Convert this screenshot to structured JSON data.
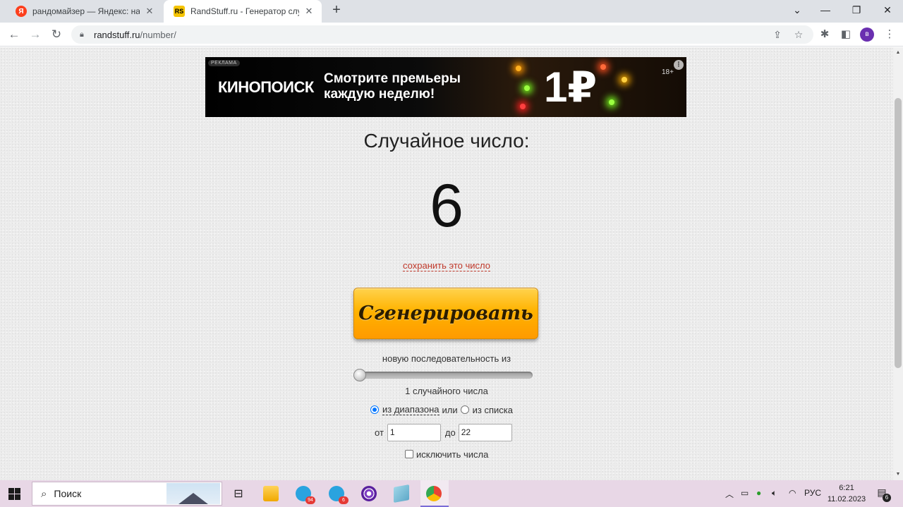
{
  "browser": {
    "tabs": [
      {
        "title": "рандомайзер — Яндекс: нашлос",
        "favicon": "yandex-icon",
        "active": false
      },
      {
        "title": "RandStuff.ru - Генератор случай",
        "favicon": "randstuff-icon",
        "active": true
      }
    ],
    "url_host": "randstuff.ru",
    "url_path": "/number/",
    "profile_initial": "в"
  },
  "ad": {
    "badge": "РЕКЛАМА",
    "brand": "КИНОПОИСК",
    "line1": "Смотрите премьеры",
    "line2": "каждую неделю!",
    "price": "1₽",
    "age": "18+"
  },
  "generator": {
    "heading": "Случайное число:",
    "number": "6",
    "save_link": "сохранить это число",
    "button": "Сгенерировать",
    "sequence_label": "новую последовательность из",
    "slider_value": 1,
    "count_label": "1 случайного числа",
    "mode_range": "из диапазона",
    "mode_or": "или",
    "mode_list": "из списка",
    "from_label": "от",
    "from_value": "1",
    "to_label": "до",
    "to_value": "22",
    "exclude_label": "исключить числа"
  },
  "taskbar": {
    "search_text": "Поиск",
    "badges": {
      "telegram1": "94",
      "telegram2": "6"
    },
    "lang": "РУС",
    "time": "6:21",
    "date": "11.02.2023",
    "notifications": "6"
  },
  "colors": {
    "link": "#c0392b",
    "button": "#ffb300",
    "radio": "#0075ff"
  }
}
